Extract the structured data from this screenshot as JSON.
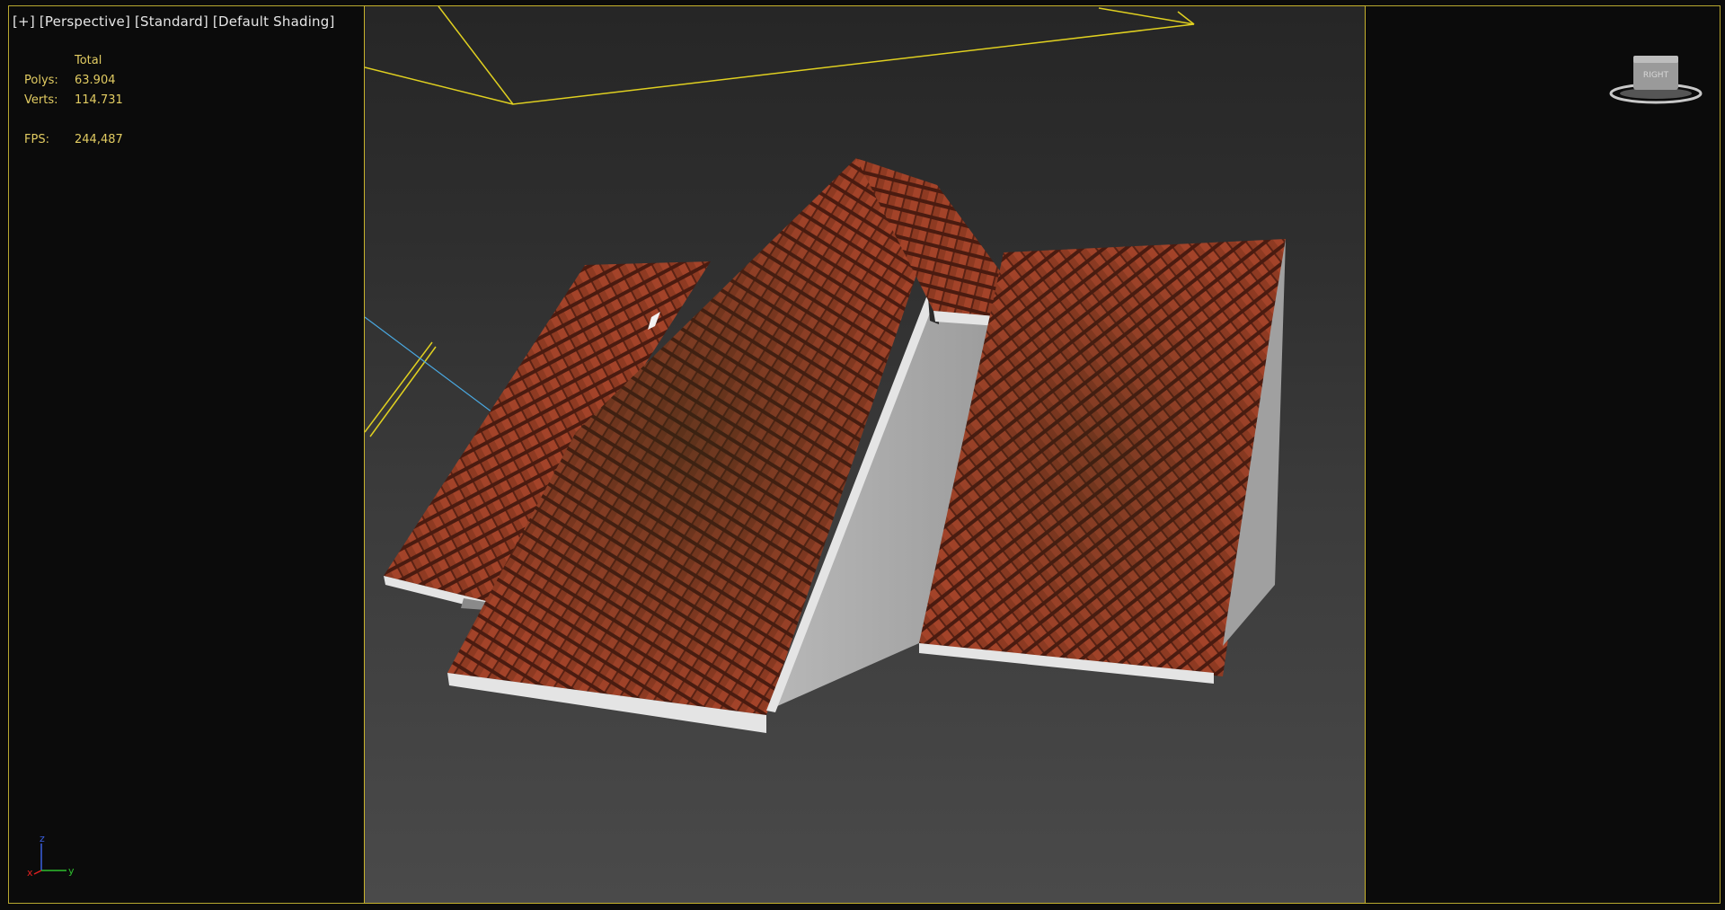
{
  "viewport": {
    "label_parts": [
      "[+]",
      "[Perspective]",
      "[Standard]",
      "[Default Shading]"
    ]
  },
  "stats": {
    "header": "Total",
    "polys_label": "Polys:",
    "polys_value": "63.904",
    "verts_label": "Verts:",
    "verts_value": "114.731",
    "fps_label": "FPS:",
    "fps_value": "244,487"
  },
  "viewcube": {
    "face_label": "RIGHT"
  },
  "axis_tripod": {
    "x": "x",
    "y": "y",
    "z": "z"
  },
  "colors": {
    "frame": "#c7b22c",
    "roof_tile": "#8e3a22",
    "wall": "#a5a5a5",
    "trim": "#e4e4e4",
    "stats_text": "#e2cc62",
    "camera_line": "#e0d020",
    "light_line": "#4aa8e0"
  },
  "scene": {
    "object": "roof-tile-model"
  }
}
